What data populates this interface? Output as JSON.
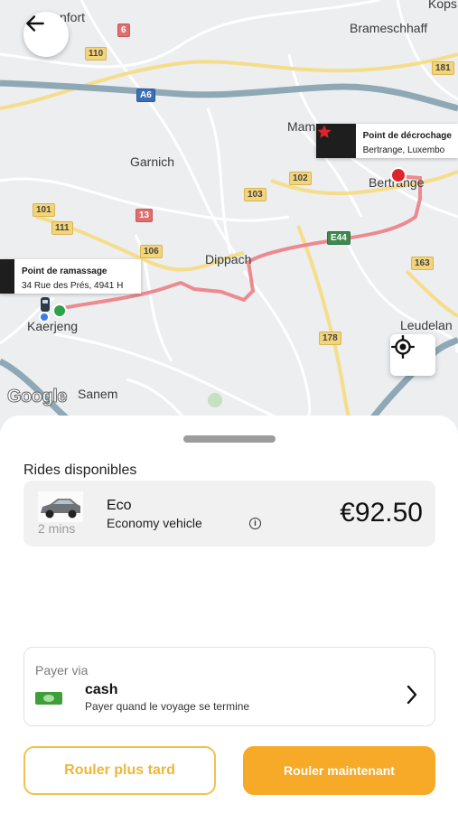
{
  "map": {
    "places": {
      "mondorf": "nfort",
      "brameschhaff": "Brameschhaff",
      "kopstal": "Kops",
      "garnich": "Garnich",
      "mamer": "Mam",
      "bertrange": "Bertrange",
      "dippach": "Dippach",
      "kaerjeng": "Kaerjeng",
      "sanem": "Sanem",
      "leudelange": "Leudelan"
    },
    "road_shields": {
      "r6": "6",
      "r110": "110",
      "r181": "181",
      "a6": "A6",
      "r102": "102",
      "r103": "103",
      "r13": "13",
      "r101": "101",
      "r111": "111",
      "r106": "106",
      "e44": "E44",
      "r163": "163",
      "r178": "178"
    },
    "pickup": {
      "title": "Point de ramassage",
      "address": "34 Rue des Prés, 4941 H"
    },
    "dropoff": {
      "title": "Point de décrochage",
      "address": "Bertrange, Luxembo"
    },
    "attribution": "Google",
    "route_color": "#ec8a8f"
  },
  "sheet": {
    "section_title": "Rides disponibles",
    "ride": {
      "eta": "2 mins",
      "name": "Eco",
      "description": "Economy vehicle",
      "info_symbol": "i",
      "price": "€92.50"
    },
    "payment": {
      "label": "Payer via",
      "method": "cash",
      "subtitle": "Payer quand le voyage se termine",
      "chevron": "›"
    },
    "buttons": {
      "later": "Rouler plus tard",
      "now": "Rouler maintenant"
    }
  },
  "icons": {
    "back": "arrow-left-icon",
    "locate": "my-location-icon",
    "pickup_marker": "car-icon",
    "dropoff_marker": "star-icon",
    "payment": "cash-icon",
    "chevron": "chevron-right-icon",
    "info": "info-icon"
  },
  "colors": {
    "accent": "#f7a928",
    "accent_border": "#f4bf4f",
    "card_background": "#f1f1f1"
  }
}
